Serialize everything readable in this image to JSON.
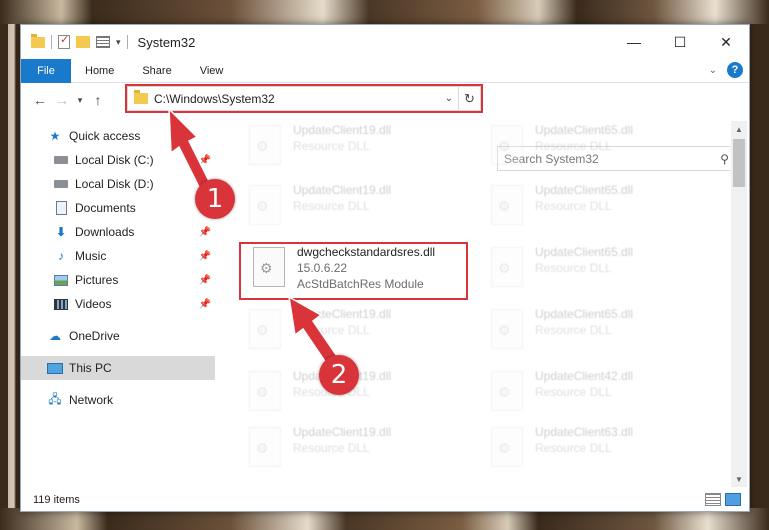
{
  "window": {
    "title": "System32",
    "controls": {
      "minimize": "—",
      "maximize": "☐",
      "close": "✕"
    }
  },
  "ribbon": {
    "file": "File",
    "tabs": [
      "Home",
      "Share",
      "View"
    ]
  },
  "navigation": {
    "address": "C:\\Windows\\System32",
    "search_placeholder": "Search System32"
  },
  "sidebar": {
    "items": [
      {
        "label": "Quick access",
        "icon": "star-icon",
        "pinned": false
      },
      {
        "label": "Local Disk (C:)",
        "icon": "disk-icon",
        "pinned": true
      },
      {
        "label": "Local Disk (D:)",
        "icon": "disk-icon",
        "pinned": false
      },
      {
        "label": "Documents",
        "icon": "documents-icon",
        "pinned": true
      },
      {
        "label": "Downloads",
        "icon": "download-icon",
        "pinned": true
      },
      {
        "label": "Music",
        "icon": "music-icon",
        "pinned": true
      },
      {
        "label": "Pictures",
        "icon": "pictures-icon",
        "pinned": true
      },
      {
        "label": "Videos",
        "icon": "videos-icon",
        "pinned": true
      },
      {
        "label": "OneDrive",
        "icon": "cloud-icon",
        "pinned": false
      },
      {
        "label": "This PC",
        "icon": "computer-icon",
        "pinned": false,
        "selected": true
      },
      {
        "label": "Network",
        "icon": "network-icon",
        "pinned": false
      }
    ]
  },
  "files": [
    {
      "name": "UpdateClient19.dll",
      "sub1": "Resource DLL",
      "faded": true
    },
    {
      "name": "UpdateClient65.dll",
      "sub1": "Resource DLL",
      "faded": true
    },
    {
      "name": "UpdateClient19.dll",
      "sub1": "Resource DLL",
      "faded": true
    },
    {
      "name": "UpdateClient65.dll",
      "sub1": "Resource DLL",
      "faded": true
    },
    {
      "name": "dwgcheckstandardsres.dll",
      "sub1": "15.0.6.22",
      "sub2": "AcStdBatchRes Module",
      "faded": false
    },
    {
      "name": "UpdateClient65.dll",
      "sub1": "Resource DLL",
      "faded": true
    },
    {
      "name": "UpdateClient19.dll",
      "sub1": "Resource DLL",
      "faded": true
    },
    {
      "name": "UpdateClient65.dll",
      "sub1": "Resource DLL",
      "faded": true
    },
    {
      "name": "UpdateClient19.dll",
      "sub1": "Resource DLL",
      "faded": true
    },
    {
      "name": "UpdateClient42.dll",
      "sub1": "Resource DLL",
      "faded": true
    },
    {
      "name": "UpdateClient19.dll",
      "sub1": "Resource DLL",
      "faded": true
    },
    {
      "name": "UpdateClient63.dll",
      "sub1": "Resource DLL",
      "faded": true
    }
  ],
  "status": {
    "count": "119 items"
  },
  "callouts": {
    "one": "1",
    "two": "2"
  },
  "colors": {
    "accent": "#1979ca",
    "highlight": "#d9343a"
  }
}
